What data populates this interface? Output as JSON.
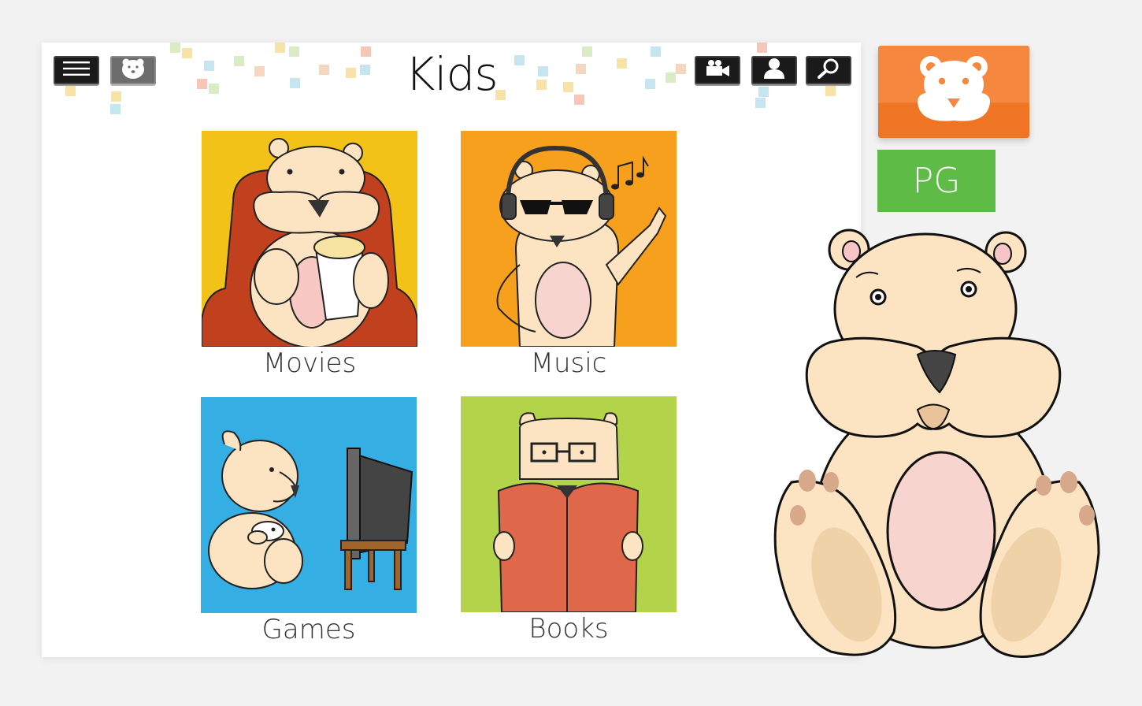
{
  "app": {
    "title": "Kids",
    "rating": "PG"
  },
  "toolbar": {
    "left": [
      {
        "name": "menu-icon"
      },
      {
        "name": "bear-icon"
      }
    ],
    "right": [
      {
        "name": "video-camera-icon"
      },
      {
        "name": "user-icon"
      },
      {
        "name": "search-icon"
      }
    ]
  },
  "tiles": [
    {
      "label": "Movies",
      "bg": "#f3c218"
    },
    {
      "label": "Music",
      "bg": "#f7a01d"
    },
    {
      "label": "Games",
      "bg": "#35aee4"
    },
    {
      "label": "Books",
      "bg": "#b3d44a"
    }
  ],
  "colors": {
    "accent_orange": "#f5883e",
    "rating_green": "#5dbb46",
    "bear_fur": "#fce3c1",
    "bear_belly": "#f8d4cf"
  }
}
